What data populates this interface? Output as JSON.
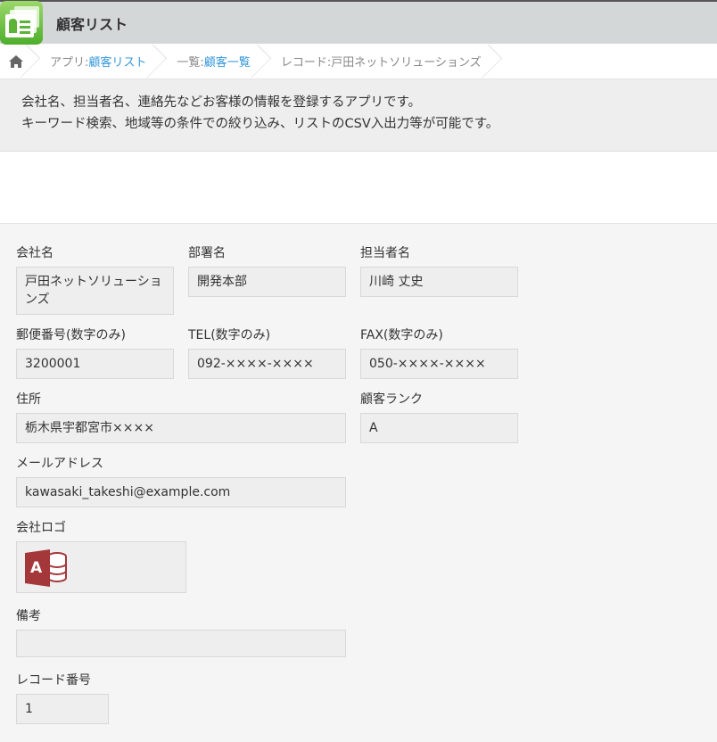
{
  "header": {
    "title": "顧客リスト"
  },
  "breadcrumb": [
    {
      "prefix": "アプリ: ",
      "link": "顧客リスト"
    },
    {
      "prefix": "一覧: ",
      "link": "顧客一覧"
    },
    {
      "prefix": "レコード: ",
      "link": "戸田ネットソリューションズ"
    }
  ],
  "description": {
    "line1": "会社名、担当者名、連絡先などお客様の情報を登録するアプリです。",
    "line2": "キーワード検索、地域等の条件での絞り込み、リストのCSV入出力等が可能です。"
  },
  "fields": {
    "company": {
      "label": "会社名",
      "value": "戸田ネットソリューションズ"
    },
    "dept": {
      "label": "部署名",
      "value": "開発本部"
    },
    "person": {
      "label": "担当者名",
      "value": "川崎 丈史"
    },
    "zip": {
      "label": "郵便番号(数字のみ)",
      "value": "3200001"
    },
    "tel": {
      "label": "TEL(数字のみ)",
      "value": "092-××××-××××"
    },
    "fax": {
      "label": "FAX(数字のみ)",
      "value": "050-××××-××××"
    },
    "address": {
      "label": "住所",
      "value": "栃木県宇都宮市××××"
    },
    "rank": {
      "label": "顧客ランク",
      "value": "A"
    },
    "email": {
      "label": "メールアドレス",
      "value": "kawasaki_takeshi@example.com"
    },
    "logo": {
      "label": "会社ロゴ",
      "icon_letter": "A"
    },
    "notes": {
      "label": "備考",
      "value": ""
    },
    "record": {
      "label": "レコード番号",
      "value": "1"
    }
  }
}
